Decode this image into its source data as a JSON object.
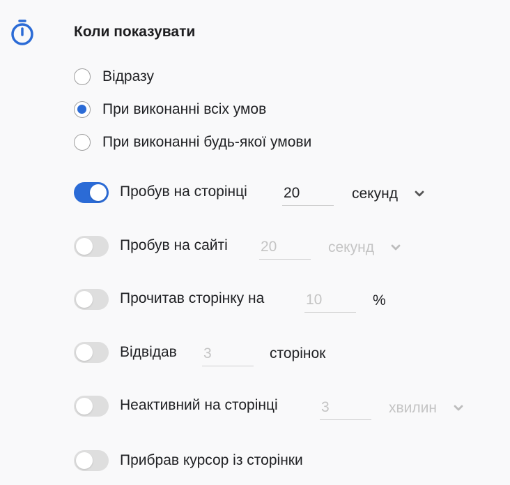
{
  "section": {
    "title": "Коли показувати"
  },
  "accent_color": "#2b6bd6",
  "radios": [
    {
      "label": "Відразу",
      "checked": false
    },
    {
      "label": "При виконанні всіх умов",
      "checked": true
    },
    {
      "label": "При виконанні будь-якої умови",
      "checked": false
    }
  ],
  "conditions": {
    "time_on_page": {
      "label": "Пробув на сторінці",
      "enabled": true,
      "value": "20",
      "unit": "секунд"
    },
    "time_on_site": {
      "label": "Пробув на сайті",
      "enabled": false,
      "value": "20",
      "unit": "секунд"
    },
    "read_page": {
      "label": "Прочитав сторінку на",
      "enabled": false,
      "value": "10",
      "unit": "%"
    },
    "visited": {
      "label": "Відвідав",
      "enabled": false,
      "value": "3",
      "unit": "сторінок"
    },
    "inactive": {
      "label": "Неактивний на сторінці",
      "enabled": false,
      "value": "3",
      "unit": "хвилин"
    },
    "cursor_left": {
      "label": "Прибрав курсор із сторінки",
      "enabled": false
    }
  }
}
